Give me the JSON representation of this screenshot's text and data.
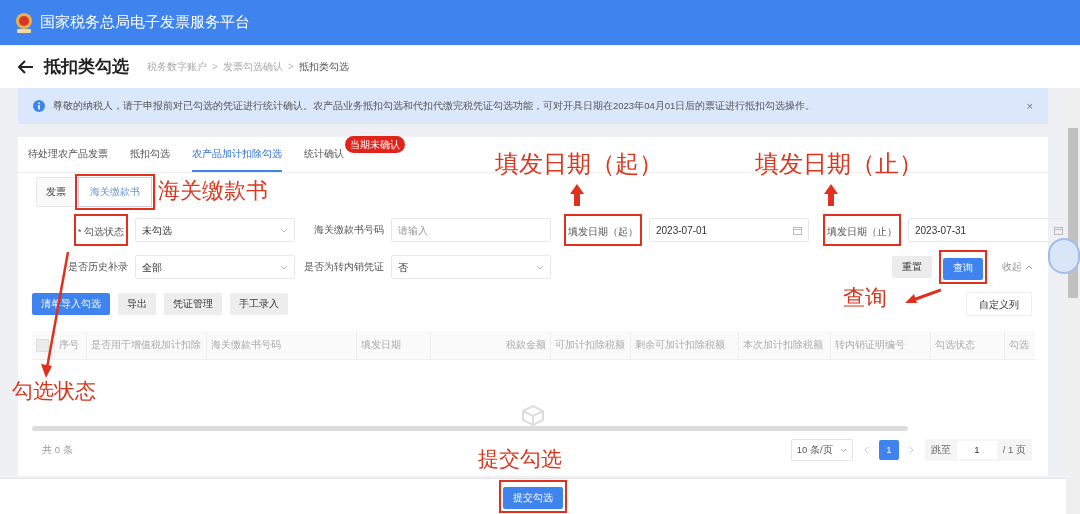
{
  "header": {
    "title": "国家税务总局电子发票服务平台"
  },
  "page": {
    "title": "抵扣类勾选",
    "breadcrumb": [
      "税务数字账户",
      "发票勾选确认",
      "抵扣类勾选"
    ],
    "separator": ">"
  },
  "alert": {
    "text": "尊敬的纳税人，请于申报前对已勾选的凭证进行统计确认。农产品业务抵扣勾选和代扣代缴完税凭证勾选功能，可对开具日期在2023年04月01日后的票证进行抵扣勾选操作。",
    "close": "×"
  },
  "tabs": [
    {
      "label": "待处理农产品发票",
      "selected": false
    },
    {
      "label": "抵扣勾选",
      "selected": false
    },
    {
      "label": "农产品加计扣除勾选",
      "selected": true
    },
    {
      "label": "统计确认",
      "selected": false,
      "badge": "当期未确认"
    }
  ],
  "subtabs": [
    {
      "label": "发票",
      "selected": false,
      "highlighted": false
    },
    {
      "label": "海关缴款书",
      "selected": true,
      "highlighted": true
    }
  ],
  "filters": [
    {
      "label": "* 勾选状态",
      "kind": "select",
      "value": "未勾选",
      "highlighted": true
    },
    {
      "label": "海关缴款书号码",
      "kind": "text",
      "placeholder": "请输入",
      "highlighted": false
    },
    {
      "label": "填发日期（起）",
      "kind": "date",
      "value": "2023-07-01",
      "highlighted": true
    },
    {
      "label": "填发日期（止）",
      "kind": "date",
      "value": "2023-07-31",
      "highlighted": true
    },
    {
      "label": "是否历史补录",
      "kind": "select",
      "value": "全部",
      "highlighted": false
    },
    {
      "label": "是否为转内销凭证",
      "kind": "select",
      "value": "否",
      "highlighted": false
    }
  ],
  "query_buttons": [
    {
      "label": "重置",
      "primary": false,
      "highlighted": false
    },
    {
      "label": "查询",
      "primary": true,
      "highlighted": true
    }
  ],
  "collapse": "收起",
  "actions": [
    {
      "label": "清单导入勾选",
      "primary": true
    },
    {
      "label": "导出",
      "primary": false
    },
    {
      "label": "凭证管理",
      "primary": false
    },
    {
      "label": "手工录入",
      "primary": false
    }
  ],
  "custom_columns": "自定义列",
  "table": {
    "select_all_checked": false,
    "columns": [
      "序号",
      "是否用于增值税加计扣除",
      "海关缴款书号码",
      "填发日期",
      "税款金额",
      "可加计扣除税额",
      "剩余可加计扣除税额",
      "本次加计扣除税额",
      "转内销证明编号",
      "勾选状态",
      "勾选"
    ]
  },
  "footer": {
    "total": "共 0 条",
    "page_size": "10 条/页",
    "pages": [
      {
        "label": "1",
        "selected": true
      }
    ],
    "jump_label": "跳至",
    "jump_value": "1",
    "page_count": "/ 1 页"
  },
  "submit": {
    "label": "提交勾选",
    "highlighted": true
  },
  "annotations": [
    {
      "text": "海关缴款书"
    },
    {
      "text": "填发日期（起）"
    },
    {
      "text": "填发日期（止）"
    },
    {
      "text": "查询"
    },
    {
      "text": "勾选状态"
    },
    {
      "text": "提交勾选"
    }
  ]
}
